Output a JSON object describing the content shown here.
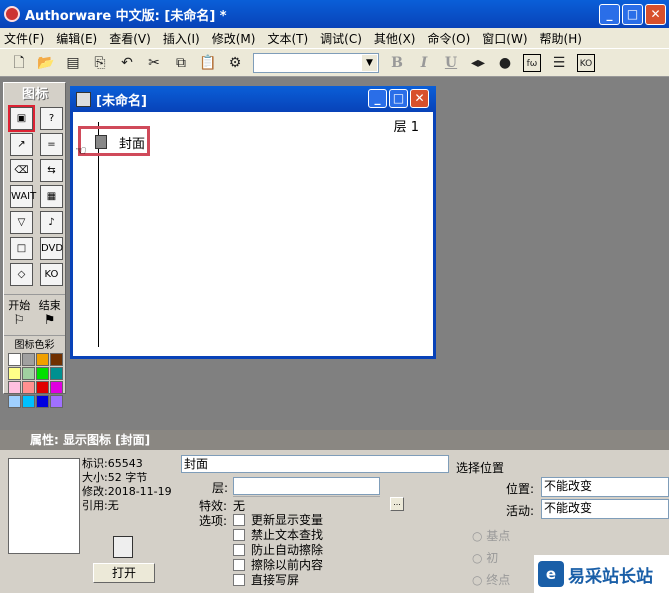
{
  "window": {
    "title": "Authorware 中文版: [未命名] *",
    "min": "_",
    "max": "□",
    "close": "✕"
  },
  "menu": [
    "文件(F)",
    "编辑(E)",
    "查看(V)",
    "插入(I)",
    "修改(M)",
    "文本(T)",
    "调试(C)",
    "其他(X)",
    "命令(O)",
    "窗口(W)",
    "帮助(H)"
  ],
  "toolbar": {
    "bold": "B",
    "italic": "I",
    "underline": "U",
    "font_value": ""
  },
  "palette": {
    "title": "图标",
    "icons": [
      {
        "name": "display",
        "glyph": "▣"
      },
      {
        "name": "decision",
        "glyph": "?"
      },
      {
        "name": "motion",
        "glyph": "↗"
      },
      {
        "name": "calculation",
        "glyph": "="
      },
      {
        "name": "erase",
        "glyph": "⌫"
      },
      {
        "name": "navigate",
        "glyph": "⇆"
      },
      {
        "name": "wait",
        "glyph": "WAIT"
      },
      {
        "name": "framework",
        "glyph": "▦"
      },
      {
        "name": "interaction",
        "glyph": "▽"
      },
      {
        "name": "sound",
        "glyph": "♪"
      },
      {
        "name": "map",
        "glyph": "□"
      },
      {
        "name": "dvd",
        "glyph": "DVD"
      },
      {
        "name": "decision2",
        "glyph": "◇"
      },
      {
        "name": "knowledge-object",
        "glyph": "KO"
      }
    ],
    "start": "开始",
    "end": "结束",
    "colors_title": "图标色彩",
    "colors": [
      "#ffffff",
      "#a0a0a0",
      "#f0a000",
      "#703000",
      "#ffff88",
      "#a0d0a0",
      "#00e000",
      "#009090",
      "#ffc0e0",
      "#ff9090",
      "#e00000",
      "#e000e0",
      "#a0d0ff",
      "#00c0ff",
      "#0000e0",
      "#a070ff"
    ]
  },
  "flowline": {
    "title": "[未命名]",
    "layer": "层 1",
    "node_label": "封面"
  },
  "properties": {
    "header": "属性: 显示图标 [封面]",
    "id": "标识:65543",
    "size": "大小:52 字节",
    "modified": "修改:2018-11-19",
    "ref": "引用:无",
    "open": "打开",
    "name_value": "封面",
    "layer_label": "层:",
    "layer_value": "",
    "effect_label": "特效:",
    "effect_value": "无",
    "effect_btn": "...",
    "options_label": "选项:",
    "options": [
      "更新显示变量",
      "禁止文本查找",
      "防止自动擦除",
      "擦除以前内容",
      "直接写屏"
    ],
    "select_position": "选择位置",
    "position_label": "位置:",
    "position_value": "不能改变",
    "active_label": "活动:",
    "active_value": "不能改变",
    "radios": [
      "基点",
      "初",
      "终点"
    ]
  },
  "watermark": "易采站长站"
}
